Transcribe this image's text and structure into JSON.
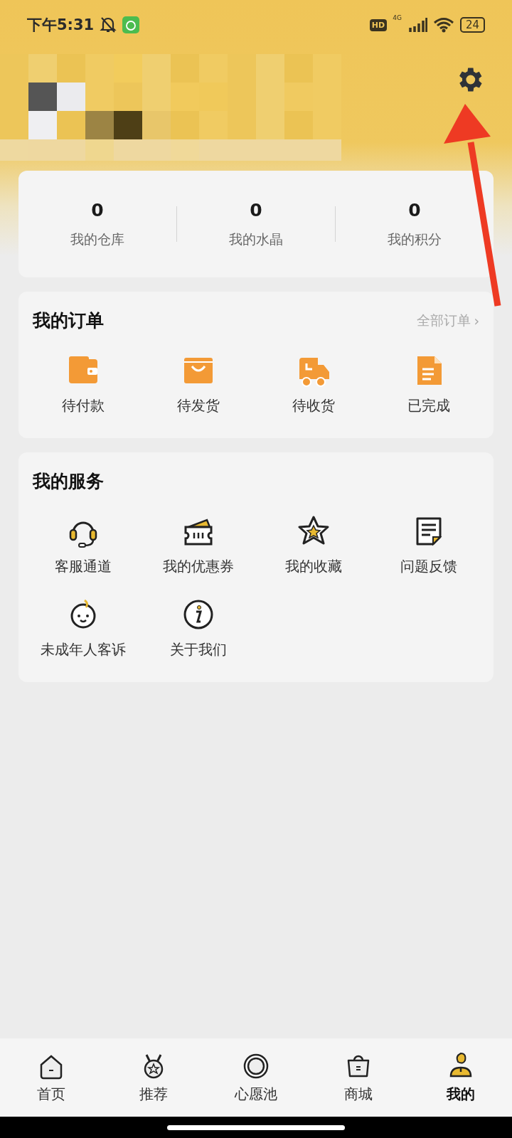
{
  "status_bar": {
    "time": "下午5:31",
    "hd": "HD",
    "network": "4G",
    "battery": "24"
  },
  "stats": [
    {
      "value": "0",
      "label": "我的仓库"
    },
    {
      "value": "0",
      "label": "我的水晶"
    },
    {
      "value": "0",
      "label": "我的积分"
    }
  ],
  "orders": {
    "title": "我的订单",
    "link": "全部订单",
    "link_arrow": "›",
    "items": [
      {
        "label": "待付款"
      },
      {
        "label": "待发货"
      },
      {
        "label": "待收货"
      },
      {
        "label": "已完成"
      }
    ]
  },
  "services": {
    "title": "我的服务",
    "items": [
      {
        "label": "客服通道"
      },
      {
        "label": "我的优惠券"
      },
      {
        "label": "我的收藏"
      },
      {
        "label": "问题反馈"
      },
      {
        "label": "未成年人客诉"
      },
      {
        "label": "关于我们"
      }
    ]
  },
  "tab_bar": [
    {
      "label": "首页",
      "selected": false
    },
    {
      "label": "推荐",
      "selected": false
    },
    {
      "label": "心愿池",
      "selected": false
    },
    {
      "label": "商城",
      "selected": false
    },
    {
      "label": "我的",
      "selected": true
    }
  ]
}
